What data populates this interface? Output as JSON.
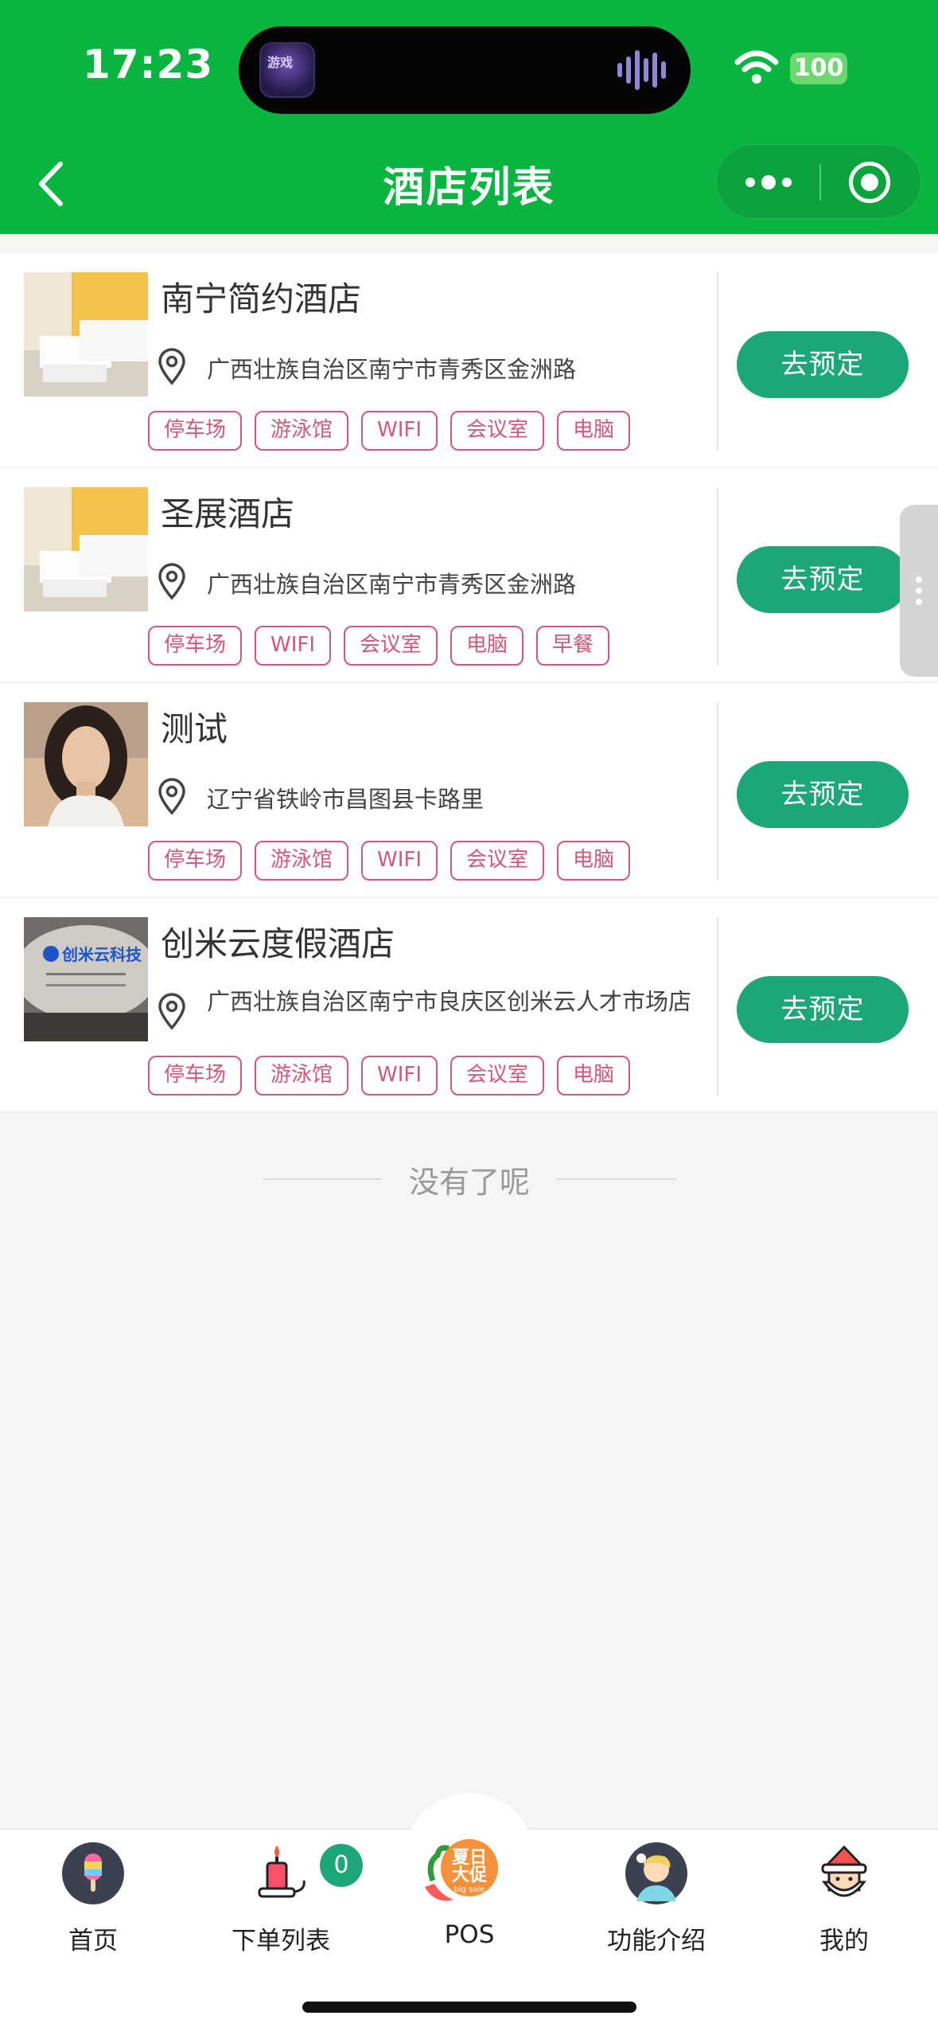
{
  "status_bar": {
    "time": "17:23",
    "battery": "100"
  },
  "nav": {
    "title": "酒店列表"
  },
  "hotels": [
    {
      "name": "南宁简约酒店",
      "address": "广西壮族自治区南宁市青秀区金洲路",
      "tags": [
        "停车场",
        "游泳馆",
        "WIFI",
        "会议室",
        "电脑"
      ],
      "book": "去预定"
    },
    {
      "name": "圣展酒店",
      "address": "广西壮族自治区南宁市青秀区金洲路",
      "tags": [
        "停车场",
        "WIFI",
        "会议室",
        "电脑",
        "早餐"
      ],
      "book": "去预定"
    },
    {
      "name": "测试",
      "address": "辽宁省铁岭市昌图县卡路里",
      "tags": [
        "停车场",
        "游泳馆",
        "WIFI",
        "会议室",
        "电脑"
      ],
      "book": "去预定"
    },
    {
      "name": "创米云度假酒店",
      "address": "广西壮族自治区南宁市良庆区创米云人才市场店",
      "tags": [
        "停车场",
        "游泳馆",
        "WIFI",
        "会议室",
        "电脑"
      ],
      "book": "去预定",
      "thumb_text": "创米云科技"
    }
  ],
  "end_text": "没有了呢",
  "tabbar": {
    "tabs": [
      {
        "label": "首页",
        "icon": "popsicle-icon"
      },
      {
        "label": "下单列表",
        "icon": "candle-icon"
      },
      {
        "label": "POS",
        "icon": "summer-sale-icon"
      },
      {
        "label": "功能介绍",
        "icon": "avatar-icon"
      },
      {
        "label": "我的",
        "icon": "santa-icon"
      }
    ],
    "order_badge": "0",
    "pos_sticker": [
      "夏日",
      "大促",
      "big sale"
    ]
  },
  "colors": {
    "header": "#08b541",
    "button": "#1da67a",
    "tag": "#d4577a"
  }
}
